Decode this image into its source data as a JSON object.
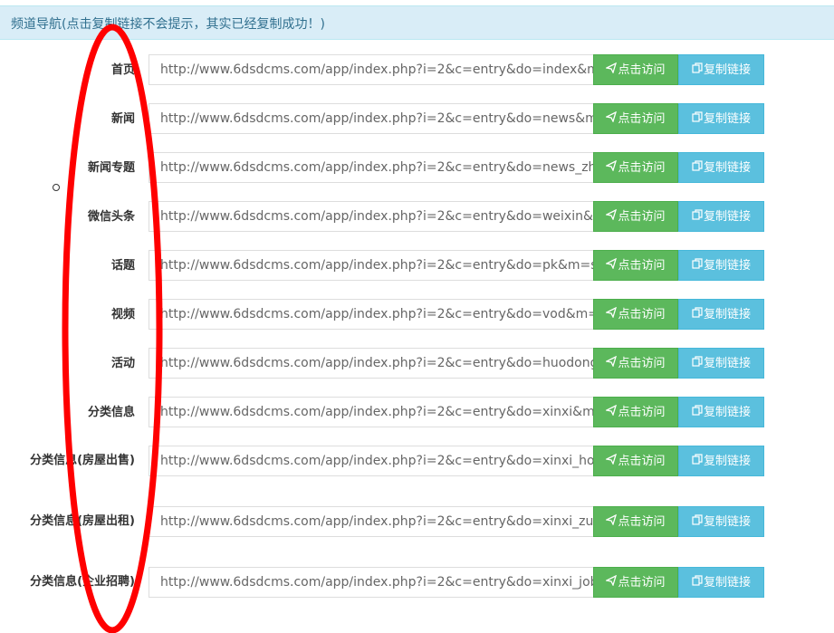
{
  "header": {
    "title": "频道导航(点击复制链接不会提示，其实已经复制成功！)"
  },
  "buttons": {
    "visit_label": "点击访问",
    "copy_label": "复制链接",
    "visit_icon": "send-icon",
    "copy_icon": "copy-icon"
  },
  "rows": [
    {
      "label": "首页",
      "url": "http://www.6dsdcms.com/app/index.php?i=2&c=entry&do=index&m"
    },
    {
      "label": "新闻",
      "url": "http://www.6dsdcms.com/app/index.php?i=2&c=entry&do=news&m"
    },
    {
      "label": "新闻专题",
      "url": "http://www.6dsdcms.com/app/index.php?i=2&c=entry&do=news_zhu"
    },
    {
      "label": "微信头条",
      "url": "http://www.6dsdcms.com/app/index.php?i=2&c=entry&do=weixin&m"
    },
    {
      "label": "话题",
      "url": "http://www.6dsdcms.com/app/index.php?i=2&c=entry&do=pk&m=s"
    },
    {
      "label": "视频",
      "url": "http://www.6dsdcms.com/app/index.php?i=2&c=entry&do=vod&m="
    },
    {
      "label": "活动",
      "url": "http://www.6dsdcms.com/app/index.php?i=2&c=entry&do=huodong"
    },
    {
      "label": "分类信息",
      "url": "http://www.6dsdcms.com/app/index.php?i=2&c=entry&do=xinxi&m="
    },
    {
      "label": "分类信息(房屋出售)",
      "url": "http://www.6dsdcms.com/app/index.php?i=2&c=entry&do=xinxi_hou"
    },
    {
      "label": "分类信息(房屋出租)",
      "url": "http://www.6dsdcms.com/app/index.php?i=2&c=entry&do=xinxi_zuf"
    },
    {
      "label": "分类信息(企业招聘)",
      "url": "http://www.6dsdcms.com/app/index.php?i=2&c=entry&do=xinxi_job"
    }
  ],
  "annotation": {
    "color": "#ff0000"
  }
}
